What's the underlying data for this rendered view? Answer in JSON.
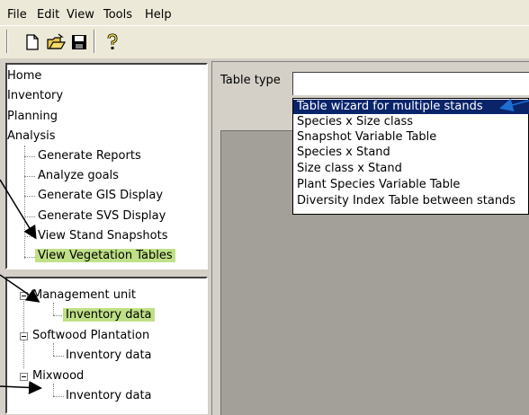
{
  "menu": [
    "File",
    "Edit",
    "View",
    "Tools",
    "Help"
  ],
  "toolbar": {
    "icons": [
      "new-document-icon",
      "open-folder-icon",
      "save-disk-icon",
      "help-question-icon"
    ]
  },
  "nav": {
    "items": [
      "Home",
      "Inventory",
      "Planning",
      "Analysis"
    ],
    "analysis_children": [
      "Generate Reports",
      "Analyze goals",
      "Generate GIS Display",
      "Generate SVS Display",
      "View Stand Snapshots",
      "View Vegetation Tables"
    ]
  },
  "tree": {
    "units": [
      {
        "name": "Management unit",
        "child": "Inventory data"
      },
      {
        "name": "Softwood Plantation",
        "child": "Inventory data"
      },
      {
        "name": "Mixwood",
        "child": "Inventory data"
      }
    ]
  },
  "table_type": {
    "label": "Table type",
    "value": "",
    "options": [
      "Table wizard for multiple stands",
      "Species x Size class",
      "Snapshot Variable Table",
      "Species x Stand",
      "Size class x Stand",
      "Plant Species Variable Table",
      "Diversity Index Table between stands"
    ],
    "selected_index": 0
  },
  "colors": {
    "highlight_green": "#bfe086",
    "selection_blue": "#0a246a",
    "arrow_blue": "#1e6fd0"
  }
}
